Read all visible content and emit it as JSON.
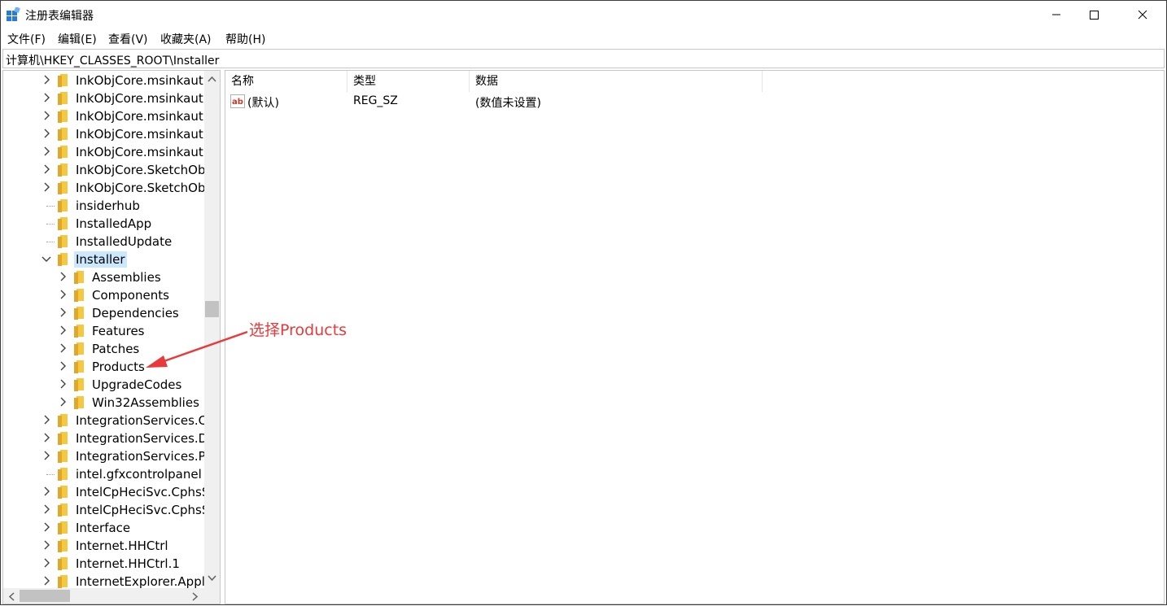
{
  "window": {
    "title": "注册表编辑器",
    "controls": {
      "minimize": "—",
      "maximize": "☐",
      "close": "✕"
    }
  },
  "menu": [
    "文件(F)",
    "编辑(E)",
    "查看(V)",
    "收藏夹(A)",
    "帮助(H)"
  ],
  "address": "计算机\\HKEY_CLASSES_ROOT\\Installer",
  "tree": [
    {
      "label": "InkObjCore.msinkaut.I",
      "level": 0,
      "expand": "collapsed"
    },
    {
      "label": "InkObjCore.msinkaut.I",
      "level": 0,
      "expand": "collapsed"
    },
    {
      "label": "InkObjCore.msinkaut.I",
      "level": 0,
      "expand": "collapsed"
    },
    {
      "label": "InkObjCore.msinkaut.I",
      "level": 0,
      "expand": "collapsed"
    },
    {
      "label": "InkObjCore.msinkaut.I",
      "level": 0,
      "expand": "collapsed"
    },
    {
      "label": "InkObjCore.SketchObj",
      "level": 0,
      "expand": "collapsed"
    },
    {
      "label": "InkObjCore.SketchObj",
      "level": 0,
      "expand": "collapsed"
    },
    {
      "label": "insiderhub",
      "level": 0,
      "expand": "none"
    },
    {
      "label": "InstalledApp",
      "level": 0,
      "expand": "none"
    },
    {
      "label": "InstalledUpdate",
      "level": 0,
      "expand": "none"
    },
    {
      "label": "Installer",
      "level": 0,
      "expand": "expanded",
      "selected": true
    },
    {
      "label": "Assemblies",
      "level": 1,
      "expand": "collapsed"
    },
    {
      "label": "Components",
      "level": 1,
      "expand": "collapsed"
    },
    {
      "label": "Dependencies",
      "level": 1,
      "expand": "collapsed"
    },
    {
      "label": "Features",
      "level": 1,
      "expand": "collapsed"
    },
    {
      "label": "Patches",
      "level": 1,
      "expand": "collapsed"
    },
    {
      "label": "Products",
      "level": 1,
      "expand": "collapsed"
    },
    {
      "label": "UpgradeCodes",
      "level": 1,
      "expand": "collapsed"
    },
    {
      "label": "Win32Assemblies",
      "level": 1,
      "expand": "collapsed"
    },
    {
      "label": "IntegrationServices.Co",
      "level": 0,
      "expand": "collapsed"
    },
    {
      "label": "IntegrationServices.D",
      "level": 0,
      "expand": "collapsed"
    },
    {
      "label": "IntegrationServices.Pa",
      "level": 0,
      "expand": "collapsed"
    },
    {
      "label": "intel.gfxcontrolpanel",
      "level": 0,
      "expand": "none"
    },
    {
      "label": "IntelCpHeciSvc.CphsS",
      "level": 0,
      "expand": "collapsed"
    },
    {
      "label": "IntelCpHeciSvc.CphsS",
      "level": 0,
      "expand": "collapsed"
    },
    {
      "label": "Interface",
      "level": 0,
      "expand": "collapsed"
    },
    {
      "label": "Internet.HHCtrl",
      "level": 0,
      "expand": "collapsed"
    },
    {
      "label": "Internet.HHCtrl.1",
      "level": 0,
      "expand": "collapsed"
    },
    {
      "label": "InternetExplorer.Appl",
      "level": 0,
      "expand": "collapsed"
    }
  ],
  "list": {
    "columns": [
      "名称",
      "类型",
      "数据"
    ],
    "rows": [
      {
        "name": "(默认)",
        "type": "REG_SZ",
        "data": "(数值未设置)",
        "icon": "string-value-icon"
      }
    ]
  },
  "annotation": {
    "text": "选择Products",
    "color": "#e83a3a"
  },
  "colors": {
    "folder": "#f5c842",
    "selection": "#cce8ff",
    "scrollbar": "#f0f0f0"
  }
}
